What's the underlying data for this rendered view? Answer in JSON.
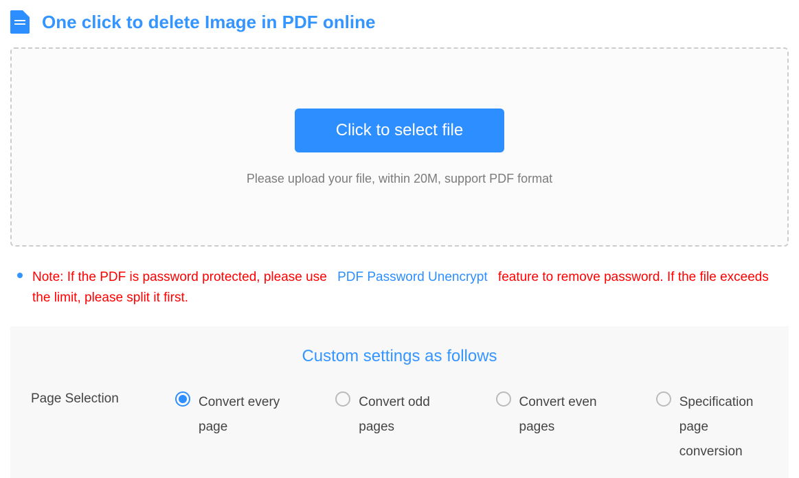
{
  "header": {
    "title": "One click to delete Image in PDF online"
  },
  "dropzone": {
    "button_label": "Click to select file",
    "hint": "Please upload your file, within 20M, support PDF format"
  },
  "note": {
    "prefix": "Note: If the PDF is password protected, please use",
    "link": "PDF Password Unencrypt",
    "suffix": "feature to remove password. If the file exceeds the limit, please split it first."
  },
  "settings": {
    "title": "Custom settings as follows",
    "page_selection_label": "Page Selection",
    "options": {
      "every": "Convert every page",
      "odd": "Convert odd pages",
      "even": "Convert even pages",
      "spec": "Specification page conversion"
    }
  }
}
